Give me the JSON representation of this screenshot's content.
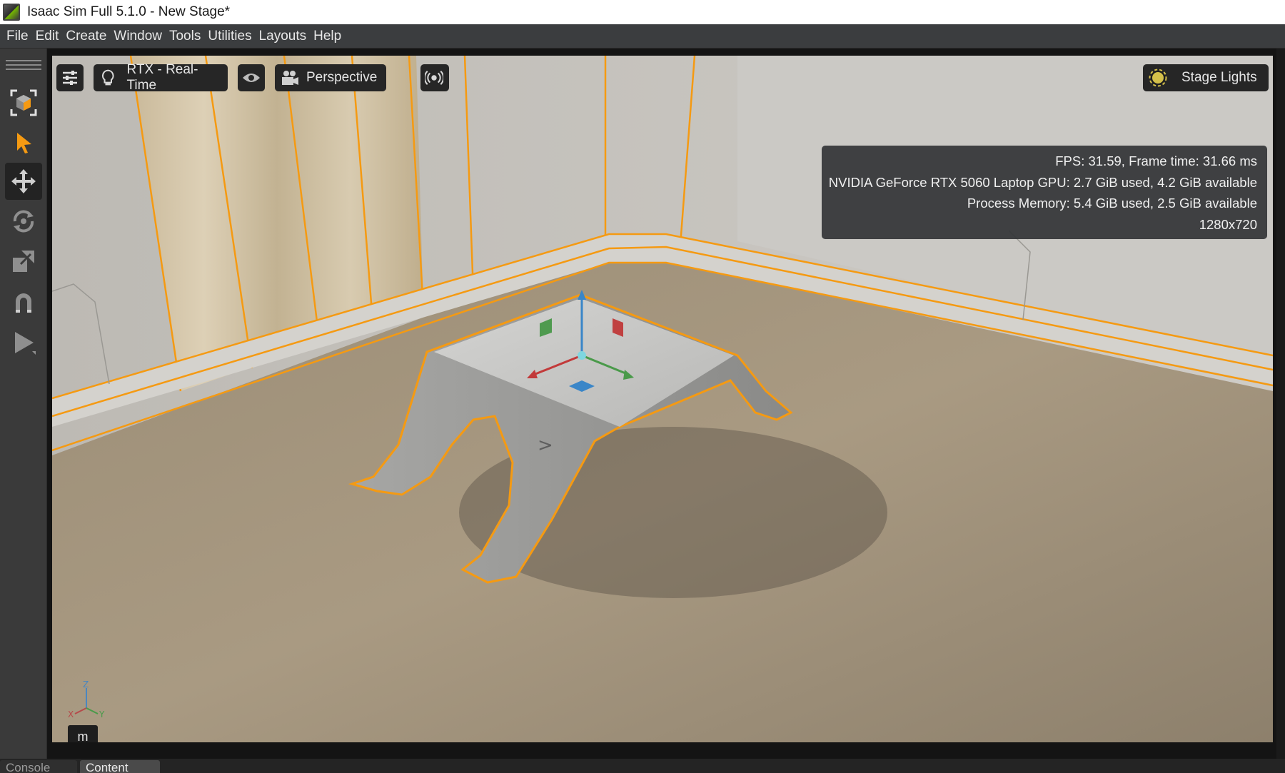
{
  "window": {
    "title": "Isaac Sim Full 5.1.0 - New Stage*"
  },
  "menu": [
    "File",
    "Edit",
    "Create",
    "Window",
    "Tools",
    "Utilities",
    "Layouts",
    "Help"
  ],
  "left_toolbar": {
    "tools": [
      {
        "name": "select-mode",
        "icon": "select-cube-icon",
        "active": false
      },
      {
        "name": "select",
        "icon": "arrow-pointer-icon",
        "active": false
      },
      {
        "name": "move",
        "icon": "move-icon",
        "active": true
      },
      {
        "name": "rotate",
        "icon": "rotate-icon",
        "active": false
      },
      {
        "name": "scale",
        "icon": "scale-icon",
        "active": false
      },
      {
        "name": "snap",
        "icon": "magnet-icon",
        "active": false
      },
      {
        "name": "play",
        "icon": "play-icon",
        "active": false
      }
    ]
  },
  "viewport": {
    "settings_icon": "sliders-icon",
    "renderer": {
      "icon": "lightbulb-icon",
      "label": "RTX - Real-Time"
    },
    "visibility_icon": "eye-icon",
    "camera": {
      "icon": "camera-icon",
      "label": "Perspective"
    },
    "sensor_icon": "broadcast-icon",
    "lighting": {
      "icon": "sun-icon",
      "label": "Stage Lights"
    },
    "stats": {
      "fps": "FPS: 31.59, Frame time: 31.66 ms",
      "gpu": "NVIDIA GeForce RTX 5060 Laptop GPU: 2.7 GiB used, 4.2 GiB available",
      "process": "Process Memory: 5.4 GiB used, 2.5 GiB available",
      "resolution": "1280x720"
    },
    "axis_labels": {
      "z": "Z",
      "x": "X",
      "y": "Y"
    },
    "units_badge": "m",
    "colors": {
      "selection_outline": "#f59a12",
      "floor": "#a89a84",
      "wall": "#c9c7c3"
    }
  },
  "bottom_tabs": [
    {
      "label": "Console",
      "active": false
    },
    {
      "label": "Content",
      "active": true
    }
  ]
}
